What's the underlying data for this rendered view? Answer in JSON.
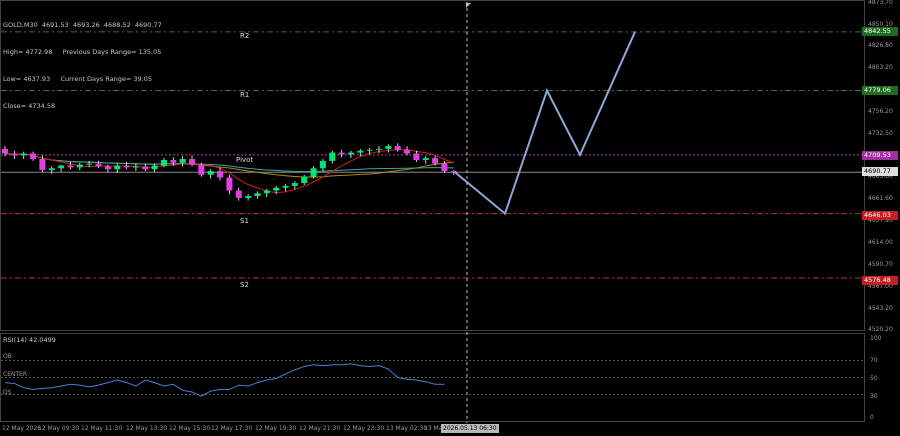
{
  "header": {
    "symbol_line": "GOLD,M30  4691.53  4693.26  4688.52  4690.77",
    "high_line": "High= 4772.98     Previous Days Range= 135.05",
    "low_line": "Low= 4637.93     Current Days Range= 39.05",
    "close_line": "Close= 4734.58"
  },
  "levels": {
    "r2": {
      "label": "R2",
      "value": 4842.55,
      "value_text": "4842.55",
      "color": "#2d7a2d"
    },
    "r1": {
      "label": "R1",
      "value": 4779.06,
      "value_text": "4779.06",
      "color": "#2d7a2d"
    },
    "pivot": {
      "label": "Pivot",
      "value": 4709.53,
      "value_text": "4709.53",
      "color": "#b040b0"
    },
    "current": {
      "value": 4690.77,
      "value_text": "4690.77"
    },
    "s1": {
      "label": "S1",
      "value": 4646.03,
      "value_text": "4646.03",
      "color": "#c03030"
    },
    "s2": {
      "label": "S2",
      "value": 4576.48,
      "value_text": "4576.48",
      "color": "#c03030"
    }
  },
  "price_axis": [
    "4873.70",
    "4850.10",
    "4826.80",
    "4803.20",
    "4779.60",
    "4756.20",
    "4732.50",
    "4709.20",
    "4685.60",
    "4661.60",
    "4637.90",
    "4614.00",
    "4590.70",
    "4567.00",
    "4543.20",
    "4520.20"
  ],
  "rsi": {
    "title": "RSI(14) 42.0499",
    "ob_label": "OB",
    "center_label": "CENTER",
    "os_label": "OS",
    "ticks": [
      "100",
      "70",
      "50",
      "30",
      "0"
    ]
  },
  "time_axis": [
    "12 May 2026",
    "12 May 09:30",
    "12 May 11:30",
    "12 May 13:30",
    "12 May 15:30",
    "12 May 17:30",
    "12 May 19:30",
    "12 May 21:30",
    "12 May 23:30",
    "13 May 02:30",
    "13 Ma"
  ],
  "cursor_time": "2026.05.13 06:30",
  "chart_data": {
    "type": "candlestick",
    "candles": [
      [
        4716,
        4719,
        4708,
        4711
      ],
      [
        4711,
        4714,
        4705,
        4709
      ],
      [
        4709,
        4713,
        4705,
        4711
      ],
      [
        4711,
        4713,
        4703,
        4705
      ],
      [
        4705,
        4709,
        4691,
        4693
      ],
      [
        4693,
        4697,
        4689,
        4695
      ],
      [
        4695,
        4699,
        4691,
        4698
      ],
      [
        4698,
        4702,
        4694,
        4696
      ],
      [
        4696,
        4701,
        4693,
        4699
      ],
      [
        4699,
        4703,
        4696,
        4700
      ],
      [
        4700,
        4703,
        4695,
        4697
      ],
      [
        4697,
        4699,
        4691,
        4694
      ],
      [
        4694,
        4700,
        4690,
        4698
      ],
      [
        4698,
        4702,
        4694,
        4696
      ],
      [
        4696,
        4700,
        4692,
        4697
      ],
      [
        4697,
        4700,
        4692,
        4694
      ],
      [
        4694,
        4700,
        4691,
        4698
      ],
      [
        4698,
        4706,
        4696,
        4704
      ],
      [
        4704,
        4707,
        4698,
        4701
      ],
      [
        4701,
        4708,
        4697,
        4705
      ],
      [
        4705,
        4709,
        4697,
        4699
      ],
      [
        4699,
        4701,
        4686,
        4688
      ],
      [
        4688,
        4694,
        4684,
        4692
      ],
      [
        4692,
        4696,
        4682,
        4685
      ],
      [
        4685,
        4688,
        4667,
        4671
      ],
      [
        4671,
        4674,
        4660,
        4663
      ],
      [
        4663,
        4667,
        4660,
        4665
      ],
      [
        4665,
        4670,
        4662,
        4668
      ],
      [
        4668,
        4673,
        4664,
        4671
      ],
      [
        4671,
        4676,
        4667,
        4674
      ],
      [
        4674,
        4678,
        4670,
        4676
      ],
      [
        4676,
        4681,
        4672,
        4679
      ],
      [
        4679,
        4688,
        4677,
        4686
      ],
      [
        4686,
        4697,
        4684,
        4695
      ],
      [
        4695,
        4705,
        4692,
        4703
      ],
      [
        4703,
        4714,
        4700,
        4712
      ],
      [
        4712,
        4715,
        4707,
        4710
      ],
      [
        4710,
        4714,
        4706,
        4712
      ],
      [
        4712,
        4716,
        4708,
        4714
      ],
      [
        4714,
        4717,
        4710,
        4715
      ],
      [
        4715,
        4719,
        4711,
        4716
      ],
      [
        4716,
        4721,
        4712,
        4719
      ],
      [
        4719,
        4722,
        4713,
        4715
      ],
      [
        4715,
        4719,
        4709,
        4711
      ],
      [
        4711,
        4714,
        4702,
        4704
      ],
      [
        4704,
        4708,
        4700,
        4706
      ],
      [
        4706,
        4709,
        4698,
        4700
      ],
      [
        4700,
        4703,
        4690,
        4692
      ],
      [
        4692,
        4693,
        4688,
        4691
      ]
    ],
    "forecast_path": [
      4690.77,
      4646.03,
      4779.06,
      4709.53,
      4842.55
    ],
    "rsi_values": [
      44,
      43,
      38,
      36,
      37,
      38,
      40,
      42,
      41,
      39,
      41,
      44,
      47,
      44,
      40,
      47,
      44,
      40,
      42,
      35,
      33,
      28,
      34,
      36,
      36,
      41,
      40,
      44,
      47,
      49,
      54,
      59,
      63,
      65,
      64,
      65,
      65,
      66,
      64,
      63,
      64,
      60,
      50,
      48,
      47,
      45,
      42,
      42
    ]
  }
}
